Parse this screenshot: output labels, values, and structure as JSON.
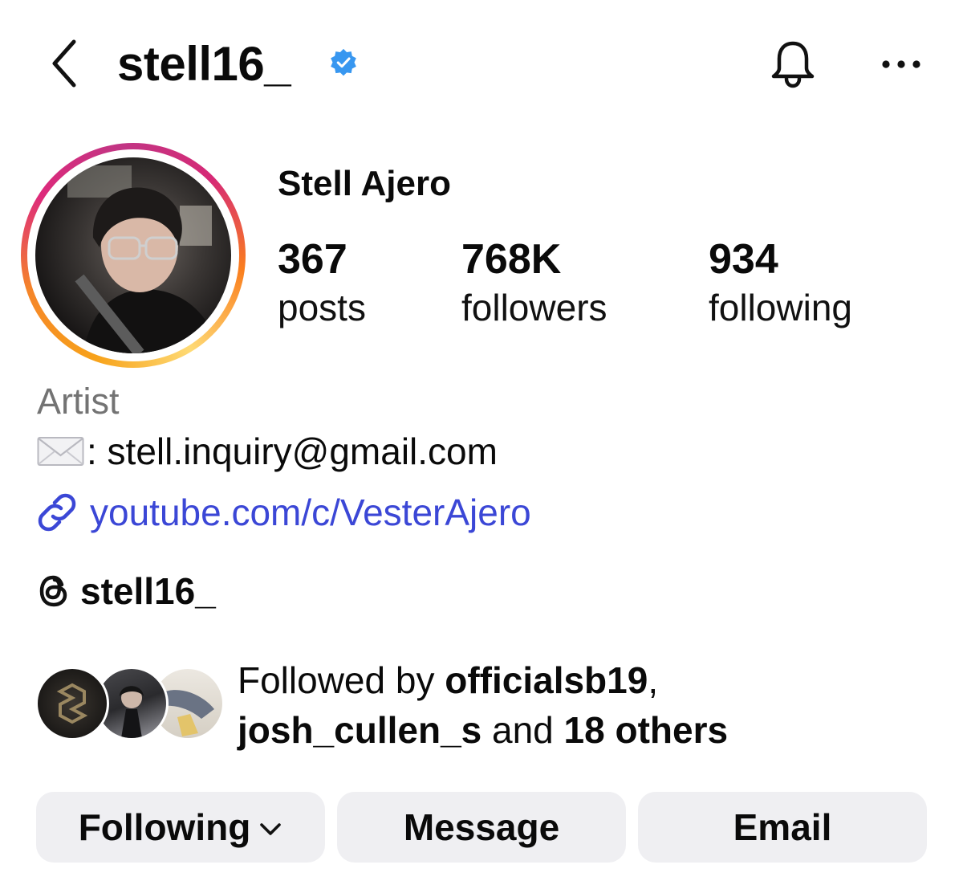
{
  "header": {
    "username": "stell16_",
    "back_icon": "chevron-left-icon",
    "verified_icon": "verified-badge-icon",
    "notifications_icon": "bell-icon",
    "more_icon": "more-horizontal-icon"
  },
  "profile": {
    "full_name": "Stell Ajero",
    "stats": [
      {
        "value": "367",
        "label": "posts"
      },
      {
        "value": "768K",
        "label": "followers"
      },
      {
        "value": "934",
        "label": "following"
      }
    ],
    "category": "Artist",
    "email_text": ": stell.inquiry@gmail.com",
    "link_text": "youtube.com/c/VesterAjero",
    "threads_handle": "stell16_"
  },
  "followed_by": {
    "prefix": "Followed by ",
    "user1": "officialsb19",
    "comma": ",",
    "user2": "josh_cullen_s",
    "connector": " and ",
    "others": "18 others"
  },
  "actions": {
    "following_label": "Following",
    "message_label": "Message",
    "email_label": "Email"
  },
  "colors": {
    "link": "#3b47d6",
    "verified": "#3897f0",
    "secondary_text": "#737373",
    "button_bg": "#efeff2"
  }
}
